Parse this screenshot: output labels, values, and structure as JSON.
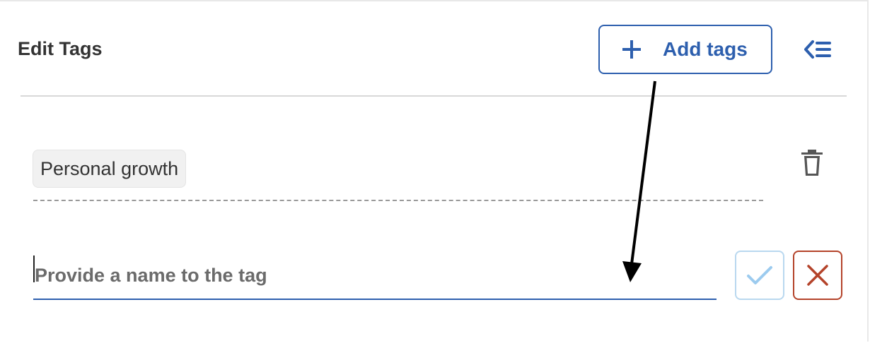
{
  "panel": {
    "title": "Edit Tags",
    "add_button_label": "Add tags",
    "add_icon": "plus-icon",
    "collapse_icon": "collapse-list-icon"
  },
  "tags": [
    {
      "label": "Personal growth",
      "delete_icon": "trash-icon"
    }
  ],
  "new_tag": {
    "value": "",
    "placeholder": "Provide a name to the tag",
    "confirm_icon": "checkmark-icon",
    "cancel_icon": "close-icon"
  },
  "colors": {
    "accent": "#2d5fae",
    "confirm_border": "#b9d8ef",
    "cancel": "#b4432a",
    "annotation_arrow": "#000000"
  }
}
